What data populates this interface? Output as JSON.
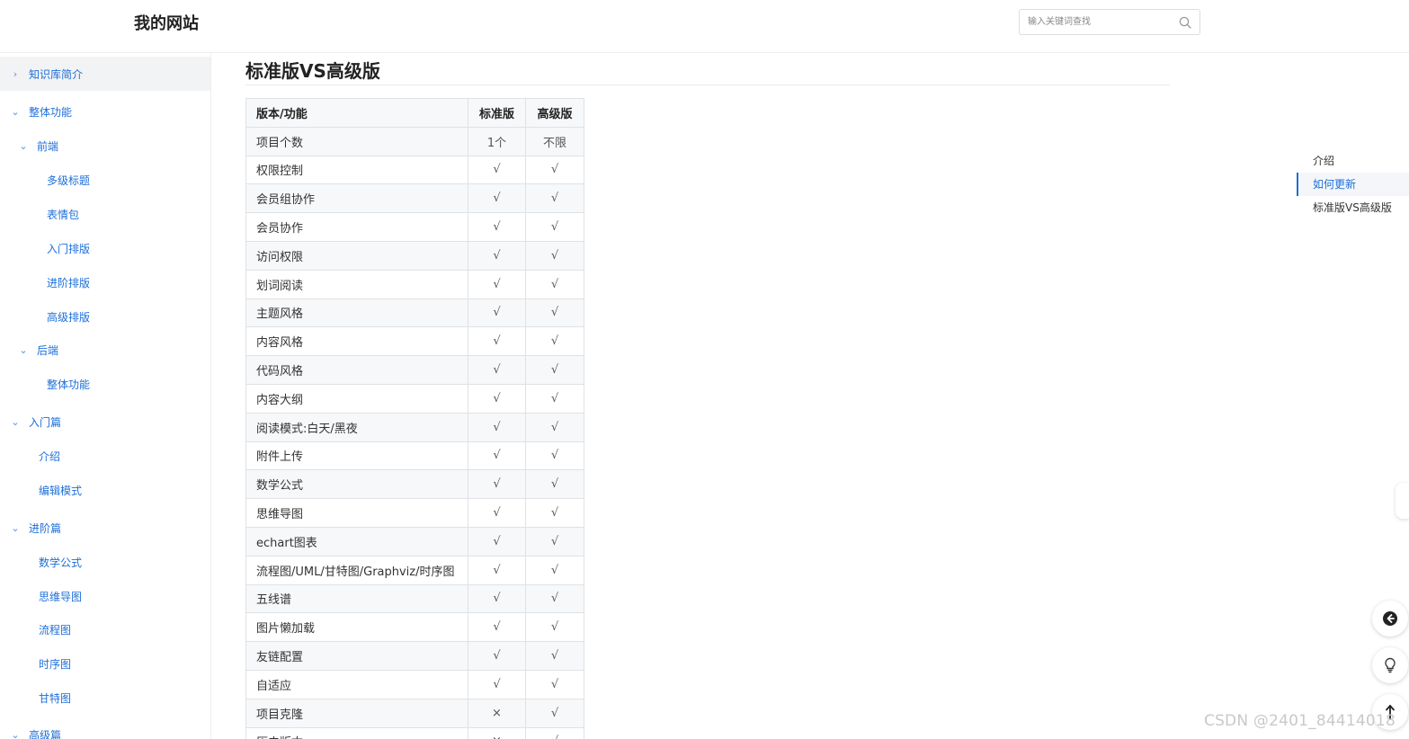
{
  "header": {
    "site_title": "我的网站",
    "search_placeholder": "输入关键词查找"
  },
  "sidebar": {
    "items": [
      {
        "label": "知识库简介",
        "arrow": "›"
      },
      {
        "label": "整体功能",
        "arrow": "⌄"
      },
      {
        "label": "前端",
        "arrow": "⌄"
      },
      {
        "label": "多级标题"
      },
      {
        "label": "表情包"
      },
      {
        "label": "入门排版"
      },
      {
        "label": "进阶排版"
      },
      {
        "label": "高级排版"
      },
      {
        "label": "后端",
        "arrow": "⌄"
      },
      {
        "label": "整体功能"
      },
      {
        "label": "入门篇",
        "arrow": "⌄"
      },
      {
        "label": "介绍"
      },
      {
        "label": "编辑模式"
      },
      {
        "label": "进阶篇",
        "arrow": "⌄"
      },
      {
        "label": "数学公式"
      },
      {
        "label": "思维导图"
      },
      {
        "label": "流程图"
      },
      {
        "label": "时序图"
      },
      {
        "label": "甘特图"
      },
      {
        "label": "高级篇",
        "arrow": "⌄"
      }
    ]
  },
  "main": {
    "title": "标准版VS高级版",
    "table": {
      "headers": [
        "版本/功能",
        "标准版",
        "高级版"
      ],
      "rows": [
        [
          "项目个数",
          "1个",
          "不限"
        ],
        [
          "权限控制",
          "√",
          "√"
        ],
        [
          "会员组协作",
          "√",
          "√"
        ],
        [
          "会员协作",
          "√",
          "√"
        ],
        [
          "访问权限",
          "√",
          "√"
        ],
        [
          "划词阅读",
          "√",
          "√"
        ],
        [
          "主题风格",
          "√",
          "√"
        ],
        [
          "内容风格",
          "√",
          "√"
        ],
        [
          "代码风格",
          "√",
          "√"
        ],
        [
          "内容大纲",
          "√",
          "√"
        ],
        [
          "阅读模式:白天/黑夜",
          "√",
          "√"
        ],
        [
          "附件上传",
          "√",
          "√"
        ],
        [
          "数学公式",
          "√",
          "√"
        ],
        [
          "思维导图",
          "√",
          "√"
        ],
        [
          "echart图表",
          "√",
          "√"
        ],
        [
          "流程图/UML/甘特图/Graphviz/时序图",
          "√",
          "√"
        ],
        [
          "五线谱",
          "√",
          "√"
        ],
        [
          "图片懒加载",
          "√",
          "√"
        ],
        [
          "友链配置",
          "√",
          "√"
        ],
        [
          "自适应",
          "√",
          "√"
        ],
        [
          "项目克隆",
          "×",
          "√"
        ],
        [
          "历史版本",
          "×",
          "√"
        ]
      ]
    }
  },
  "toc": {
    "items": [
      "介绍",
      "如何更新",
      "标准版VS高级版"
    ],
    "active_index": 1
  },
  "floating_buttons": [
    "back-icon",
    "lightbulb-icon",
    "back-to-top-icon"
  ],
  "watermark": "CSDN @2401_84414018",
  "colors": {
    "accent": "#1e6fd9",
    "sidebar_active_bg": "#f2f3f5",
    "table_stripe": "#f6f8fa"
  }
}
